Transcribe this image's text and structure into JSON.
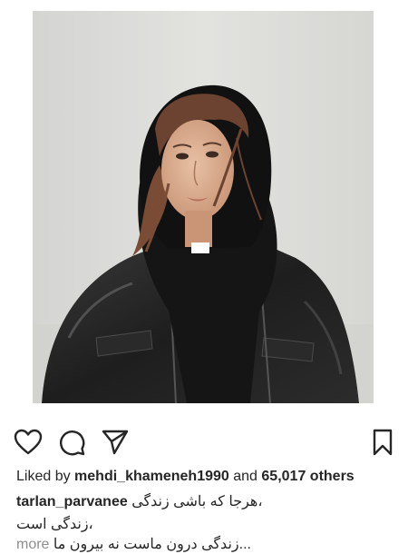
{
  "post": {
    "photo": {
      "alt": "Portrait of a woman in a black headscarf and black leather jacket"
    },
    "actions": {
      "like_icon": "heart-icon",
      "comment_icon": "comment-icon",
      "share_icon": "paper-plane-icon",
      "save_icon": "bookmark-icon"
    },
    "likes": {
      "prefix": "Liked by",
      "liker": "mehdi_khameneh1990",
      "connector": "and",
      "count_text": "65,017 others"
    },
    "caption": {
      "username": "tarlan_parvanee",
      "line1": "،هرجا که باشی زندگی",
      "line2": "،زندگی است",
      "line3": "...زندگی درون ماست نه بیرون ما",
      "more_label": "more"
    }
  }
}
